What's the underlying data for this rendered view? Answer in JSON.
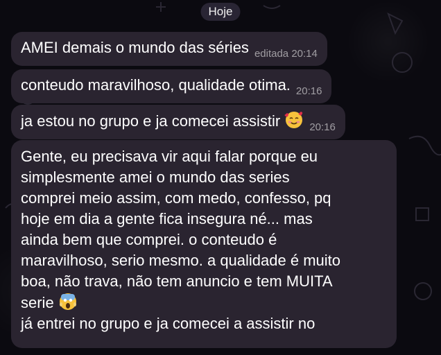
{
  "chat": {
    "date_label": "Hoje",
    "messages": [
      {
        "text": "AMEI demais o mundo das séries",
        "meta": "editada 20:14"
      },
      {
        "text": "conteudo maravilhoso, qualidade otima.",
        "meta": "20:16"
      },
      {
        "text": "ja estou no grupo e ja comecei assistir",
        "meta": "20:16",
        "emoji": "smiling-face-with-hearts-icon"
      },
      {
        "lines_before_emoji": "Gente, eu precisava vir aqui falar porque eu\nsimplesmente amei o mundo das series\ncomprei meio assim, com medo, confesso, pq\nhoje em dia a gente fica insegura né... mas\nainda bem que comprei. o conteudo é\nmaravilhoso, serio mesmo. a qualidade é muito\nboa, não trava, não tem anuncio e tem MUITA\nserie",
        "emoji": "screaming-face-icon",
        "lines_after_emoji": "já entrei no grupo e ja comecei a assistir no"
      }
    ]
  },
  "colors": {
    "background": "#0b0a10",
    "bubble": "#2a2430",
    "pill": "#2d2837"
  }
}
